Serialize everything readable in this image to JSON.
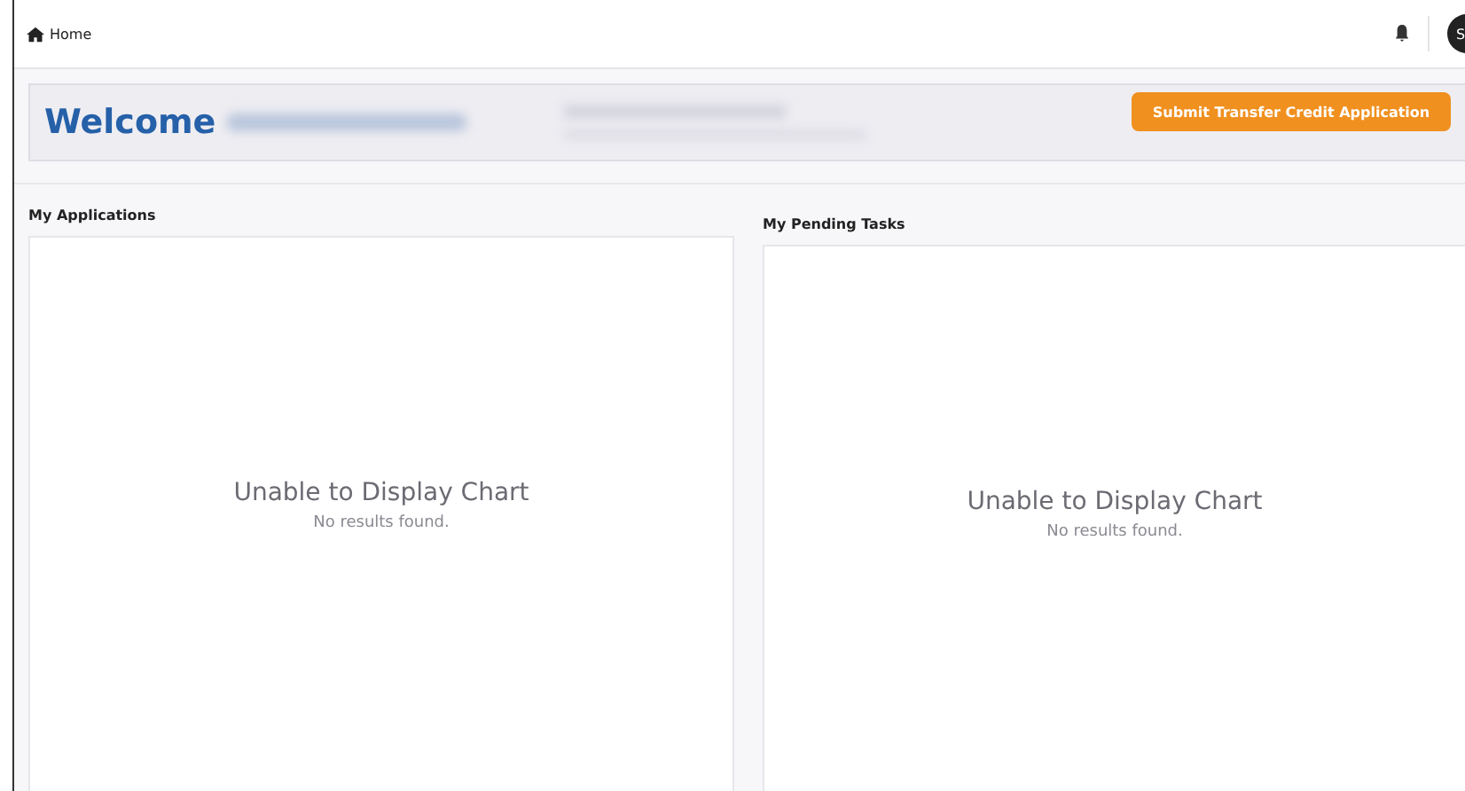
{
  "breadcrumb": {
    "label": "Home"
  },
  "avatar": {
    "initials": "S"
  },
  "banner": {
    "title": "Welcome",
    "button": "Submit Transfer Credit Application"
  },
  "panels": [
    {
      "title": "My Applications",
      "message": "Unable to Display Chart",
      "detail": "No results found."
    },
    {
      "title": "My Pending Tasks",
      "message": "Unable to Display Chart",
      "detail": "No results found."
    }
  ]
}
